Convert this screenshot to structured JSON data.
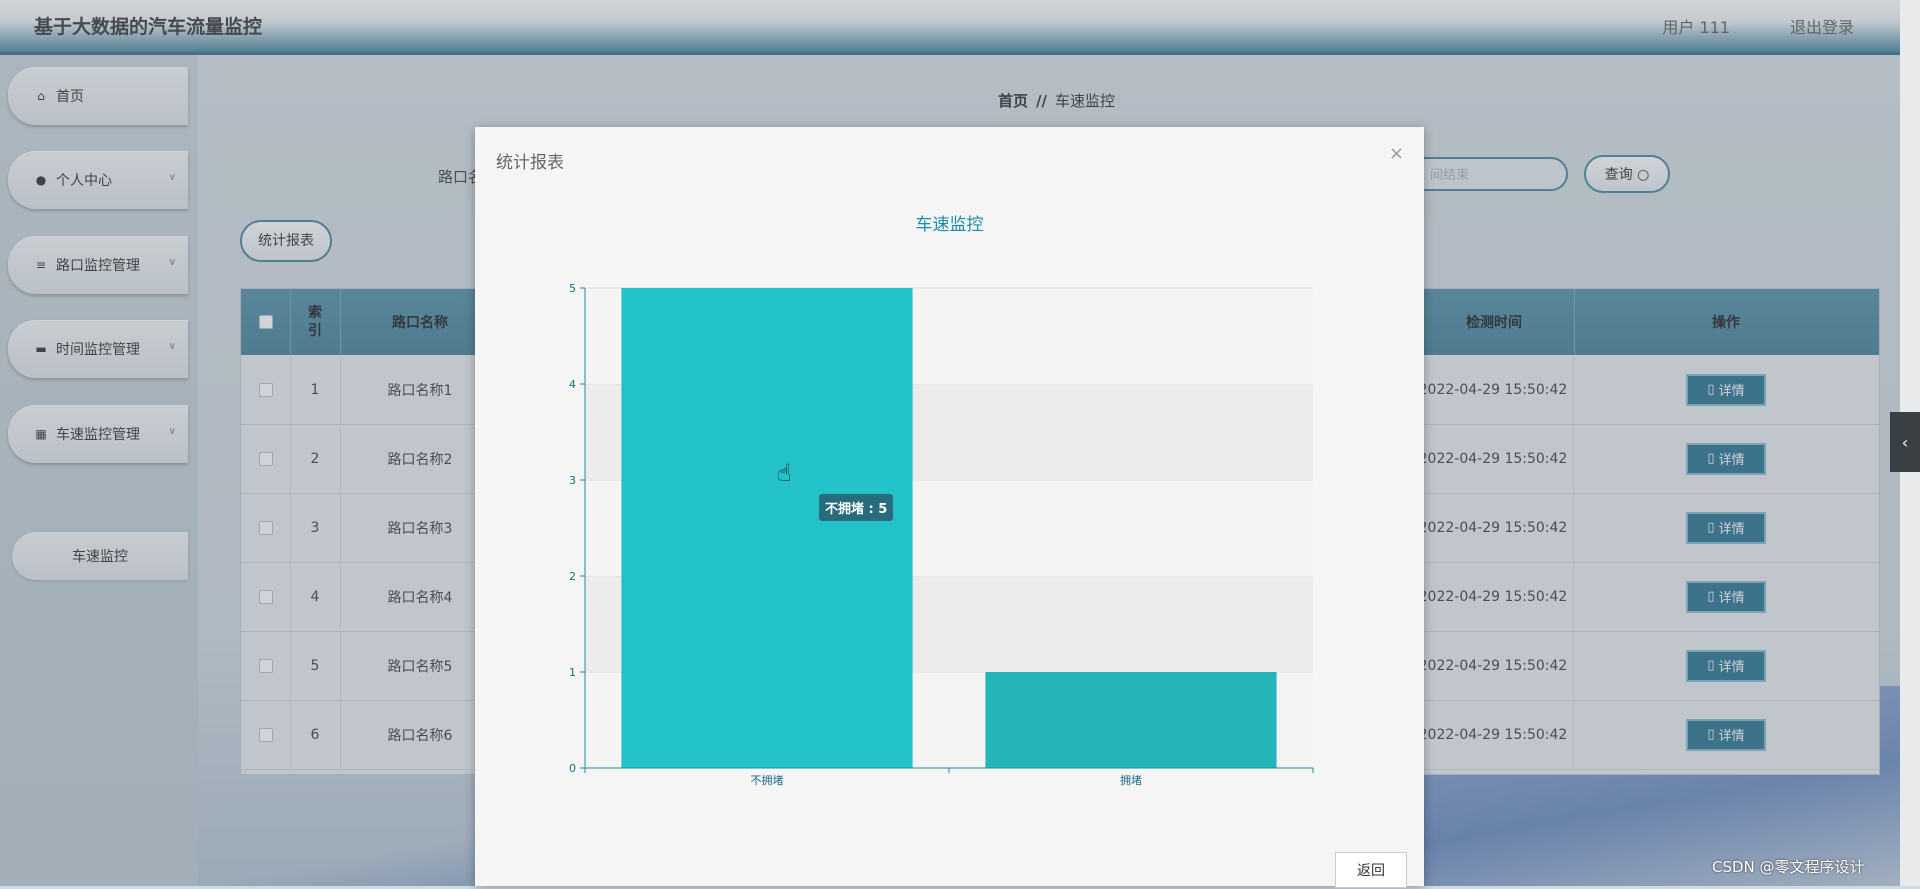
{
  "app": {
    "title": "基于大数据的汽车流量监控",
    "user_label": "用户 111",
    "logout": "退出登录"
  },
  "sidebar": {
    "items": [
      {
        "label": "首页",
        "icon": "home-icon"
      },
      {
        "label": "个人中心",
        "icon": "user-icon"
      },
      {
        "label": "路口监控管理",
        "icon": "list-icon"
      },
      {
        "label": "时间监控管理",
        "icon": "chat-icon"
      },
      {
        "label": "车速监控管理",
        "icon": "grid-icon"
      }
    ],
    "sub_item": "车速监控"
  },
  "breadcrumb": {
    "home": "首页",
    "separator": "//",
    "current": "车速监控"
  },
  "search": {
    "label": "路口名",
    "end_placeholder": "间结束",
    "query_button": "查询"
  },
  "toolbar": {
    "report_button": "统计报表"
  },
  "table": {
    "headers": {
      "index": "索引",
      "name": "路口名称",
      "time": "检测时间",
      "action": "操作"
    },
    "rows": [
      {
        "index": "1",
        "name": "路口名称1",
        "time": "2022-04-29 15:50:42"
      },
      {
        "index": "2",
        "name": "路口名称2",
        "time": "2022-04-29 15:50:42"
      },
      {
        "index": "3",
        "name": "路口名称3",
        "time": "2022-04-29 15:50:42"
      },
      {
        "index": "4",
        "name": "路口名称4",
        "time": "2022-04-29 15:50:42"
      },
      {
        "index": "5",
        "name": "路口名称5",
        "time": "2022-04-29 15:50:42"
      },
      {
        "index": "6",
        "name": "路口名称6",
        "time": "2022-04-29 15:50:42"
      }
    ],
    "detail_label": "详情"
  },
  "dialog": {
    "title": "统计报表",
    "close": "×",
    "back_button": "返回",
    "tooltip": "不拥堵 : 5"
  },
  "chart_data": {
    "type": "bar",
    "title": "车速监控",
    "categories": [
      "不拥堵",
      "拥堵"
    ],
    "values": [
      5,
      1
    ],
    "ylim": [
      0,
      5
    ],
    "yticks": [
      0,
      1,
      2,
      3,
      4,
      5
    ],
    "grid": true,
    "color": "#22c2c8"
  },
  "watermark": "CSDN @零文程序设计"
}
